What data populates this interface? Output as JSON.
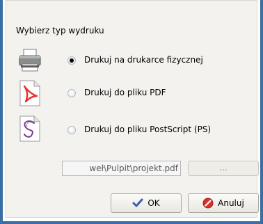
{
  "dialog": {
    "heading": "Wybierz typ wydruku",
    "options": [
      {
        "label": "Drukuj na drukarce fizycznej",
        "icon": "printer-icon",
        "selected": true
      },
      {
        "label": "Drukuj do pliku PDF",
        "icon": "pdf-file-icon",
        "selected": false
      },
      {
        "label": "Drukuj do pliku PostScript (PS)",
        "icon": "postscript-file-icon",
        "selected": false
      }
    ],
    "file_path": "weł\\Pulpit\\projekt.pdf",
    "browse_label": "...",
    "ok_label": "OK",
    "cancel_label": "Anuluj"
  },
  "colors": {
    "window_border": "#3a6ea5",
    "dialog_background": "#f3f2ef",
    "pdf_red": "#e8312a",
    "ps_purple": "#7a3a8a"
  }
}
